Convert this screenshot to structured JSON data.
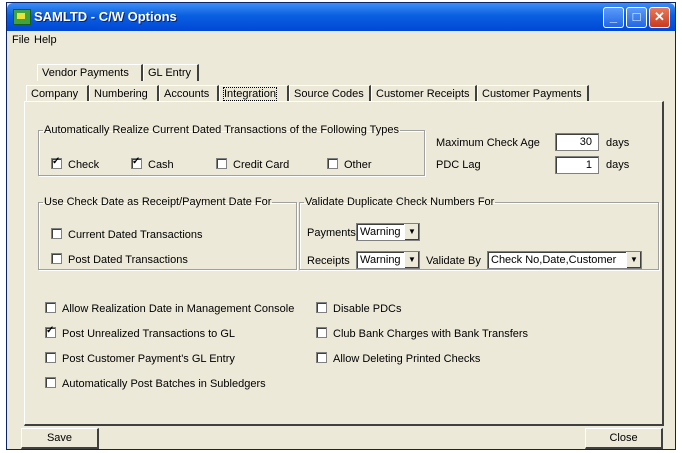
{
  "window": {
    "title": "SAMLTD - C/W Options"
  },
  "menu": {
    "file": "File",
    "help": "Help"
  },
  "tabs_row1": [
    "Vendor Payments",
    "GL Entry"
  ],
  "tabs_row2": [
    "Company",
    "Numbering",
    "Accounts",
    "Integration",
    "Source Codes",
    "Customer Receipts",
    "Customer Payments"
  ],
  "active_tab": "Integration",
  "realize": {
    "legend": "Automatically Realize Current Dated Transactions of the Following Types",
    "options": [
      {
        "label": "Check",
        "checked": true
      },
      {
        "label": "Cash",
        "checked": true
      },
      {
        "label": "Credit Card",
        "checked": false
      },
      {
        "label": "Other",
        "checked": false
      }
    ]
  },
  "max_check_age": {
    "label": "Maximum Check Age",
    "value": "30",
    "unit": "days"
  },
  "pdc_lag": {
    "label": "PDC Lag",
    "value": "1",
    "unit": "days"
  },
  "use_check_date": {
    "legend": "Use Check Date as Receipt/Payment Date For",
    "options": [
      {
        "label": "Current Dated Transactions",
        "checked": false
      },
      {
        "label": "Post Dated Transactions",
        "checked": false
      }
    ]
  },
  "validate_dup": {
    "legend": "Validate Duplicate Check Numbers For",
    "payments_label": "Payments",
    "payments_value": "Warning",
    "receipts_label": "Receipts",
    "receipts_value": "Warning",
    "validate_by_label": "Validate By",
    "validate_by_value": "Check No,Date,Customer"
  },
  "options_left": [
    {
      "label": "Allow Realization Date in Management Console",
      "checked": false
    },
    {
      "label": "Post Unrealized Transactions to GL",
      "checked": true
    },
    {
      "label": "Post Customer Payment's GL Entry",
      "checked": false
    },
    {
      "label": "Automatically Post Batches in Subledgers",
      "checked": false
    }
  ],
  "options_right": [
    {
      "label": "Disable PDCs",
      "checked": false
    },
    {
      "label": "Club Bank Charges with Bank Transfers",
      "checked": false
    },
    {
      "label": "Allow Deleting Printed Checks",
      "checked": false
    }
  ],
  "buttons": {
    "save": "Save",
    "close": "Close"
  }
}
